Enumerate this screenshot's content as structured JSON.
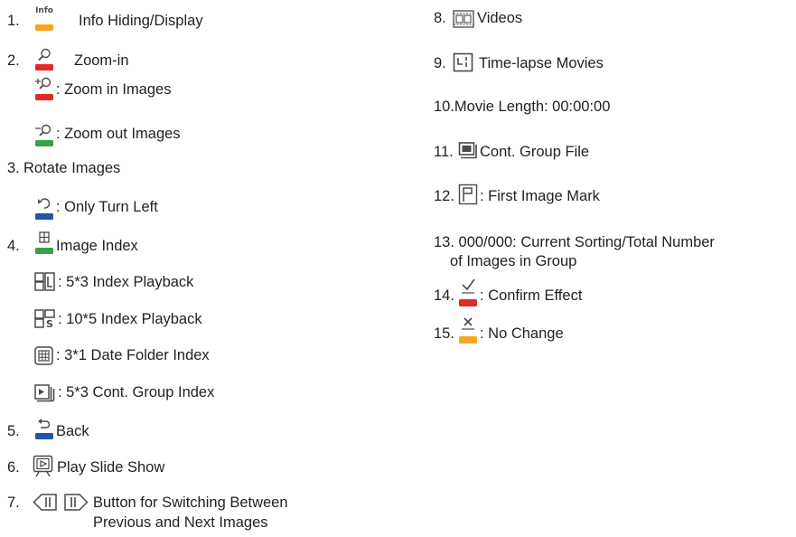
{
  "left": {
    "i1": {
      "num": "1.",
      "label": "Info Hiding/Display",
      "icon_text": "Info"
    },
    "i2": {
      "num": "2.",
      "label": "Zoom-in"
    },
    "i2a": {
      "label": ": Zoom in Images"
    },
    "i2b": {
      "label": ": Zoom out Images"
    },
    "i3": {
      "num": "3.",
      "label": "Rotate Images"
    },
    "i3a": {
      "label": ": Only Turn Left"
    },
    "i4": {
      "num": "4.",
      "label": "Image Index"
    },
    "i4a": {
      "label": ": 5*3 Index Playback"
    },
    "i4b": {
      "label": ": 10*5 Index Playback"
    },
    "i4c": {
      "label": ": 3*1 Date Folder Index"
    },
    "i4d": {
      "label": ": 5*3 Cont. Group Index"
    },
    "i5": {
      "num": "5.",
      "label": "Back"
    },
    "i6": {
      "num": "6.",
      "label": "Play Slide Show"
    },
    "i7": {
      "num": "7.",
      "label_line1": "Button for Switching Between",
      "label_line2": "Previous and Next Images"
    }
  },
  "right": {
    "i8": {
      "num": "8.",
      "label": "Videos"
    },
    "i9": {
      "num": "9.",
      "label": "Time-lapse Movies"
    },
    "i10": {
      "label": "10.Movie Length: 00:00:00"
    },
    "i11": {
      "num": "11.",
      "label": "Cont. Group File"
    },
    "i12": {
      "num": "12.",
      "label": ": First Image Mark"
    },
    "i13": {
      "label_line1": "13. 000/000: Current Sorting/Total Number",
      "label_line2": "of Images in Group"
    },
    "i14": {
      "num": "14.",
      "label": ": Confirm Effect"
    },
    "i15": {
      "num": "15.",
      "label": ": No Change"
    }
  },
  "colors": {
    "text": "#231f20",
    "orange_bar": "#f5a623",
    "red_bar": "#e02b2b",
    "green_bar": "#3aa04a",
    "blue_bar": "#1f56a6",
    "icon_stroke": "#4a4a4a"
  },
  "icons": {
    "info": "info-icon",
    "zoom": "magnifier-icon",
    "zoom_in": "zoom-in-icon",
    "zoom_out": "zoom-out-icon",
    "rotate_left": "rotate-left-icon",
    "index": "grid-index-icon",
    "back": "back-arrow-icon",
    "slideshow": "slideshow-icon",
    "prev": "prev-image-icon",
    "next": "next-image-icon",
    "video": "film-icon",
    "timelapse": "timelapse-icon",
    "cont_group": "cont-group-icon",
    "flag": "flag-icon",
    "check": "checkmark-icon",
    "cross": "cross-icon"
  }
}
